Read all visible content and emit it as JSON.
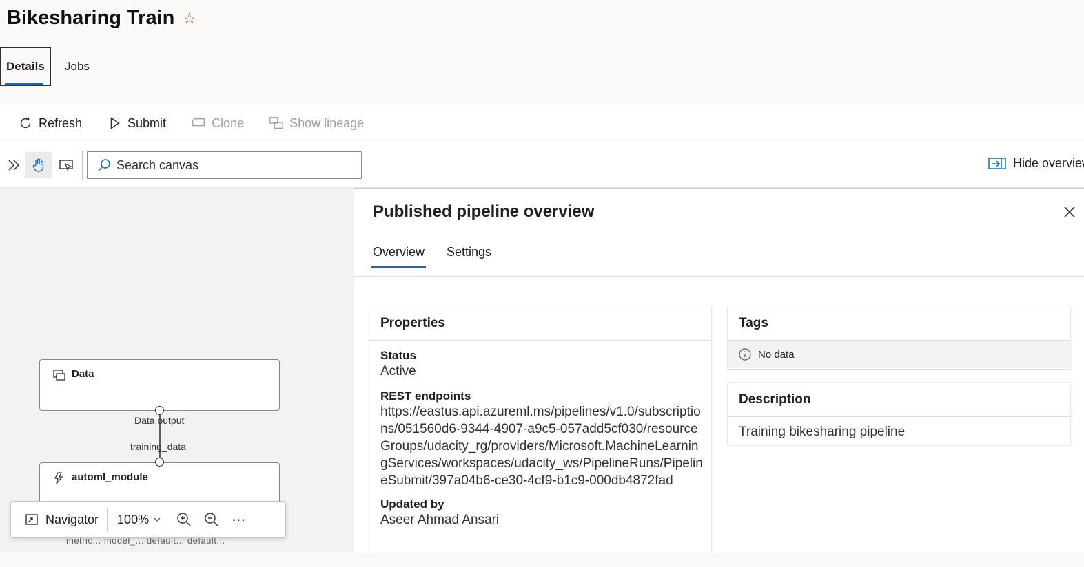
{
  "header": {
    "title": "Bikesharing Train"
  },
  "tabs": [
    {
      "label": "Details"
    },
    {
      "label": "Jobs"
    }
  ],
  "toolbar": {
    "refresh": "Refresh",
    "submit": "Submit",
    "clone": "Clone",
    "show_lineage": "Show lineage"
  },
  "canvas_bar": {
    "search_placeholder": "Search canvas",
    "hide_overview": "Hide overview"
  },
  "canvas": {
    "nodes": [
      {
        "label": "Data"
      },
      {
        "label": "automl_module"
      }
    ],
    "output_port": "Data output",
    "input_port": "training_data",
    "truncated_ports": "metric...   model_...   default...   default..."
  },
  "navigator": {
    "label": "Navigator",
    "zoom": "100%"
  },
  "panel": {
    "title": "Published pipeline overview",
    "tabs": [
      {
        "label": "Overview"
      },
      {
        "label": "Settings"
      }
    ],
    "properties": {
      "heading": "Properties",
      "status_label": "Status",
      "status_value": "Active",
      "rest_label": "REST endpoints",
      "rest_value": "https://eastus.api.azureml.ms/pipelines/v1.0/subscriptions/051560d6-9344-4907-a9c5-057add5cf030/resourceGroups/udacity_rg/providers/Microsoft.MachineLearningServices/workspaces/udacity_ws/PipelineRuns/PipelineSubmit/397a04b6-ce30-4cf9-b1c9-000db4872fad",
      "updated_label": "Updated by",
      "updated_value": "Aseer Ahmad Ansari"
    },
    "tags": {
      "heading": "Tags",
      "empty": "No data"
    },
    "description": {
      "heading": "Description",
      "value": "Training bikesharing pipeline"
    }
  },
  "colors": {
    "accent": "#0f6cbd",
    "star": "#c1440e"
  }
}
